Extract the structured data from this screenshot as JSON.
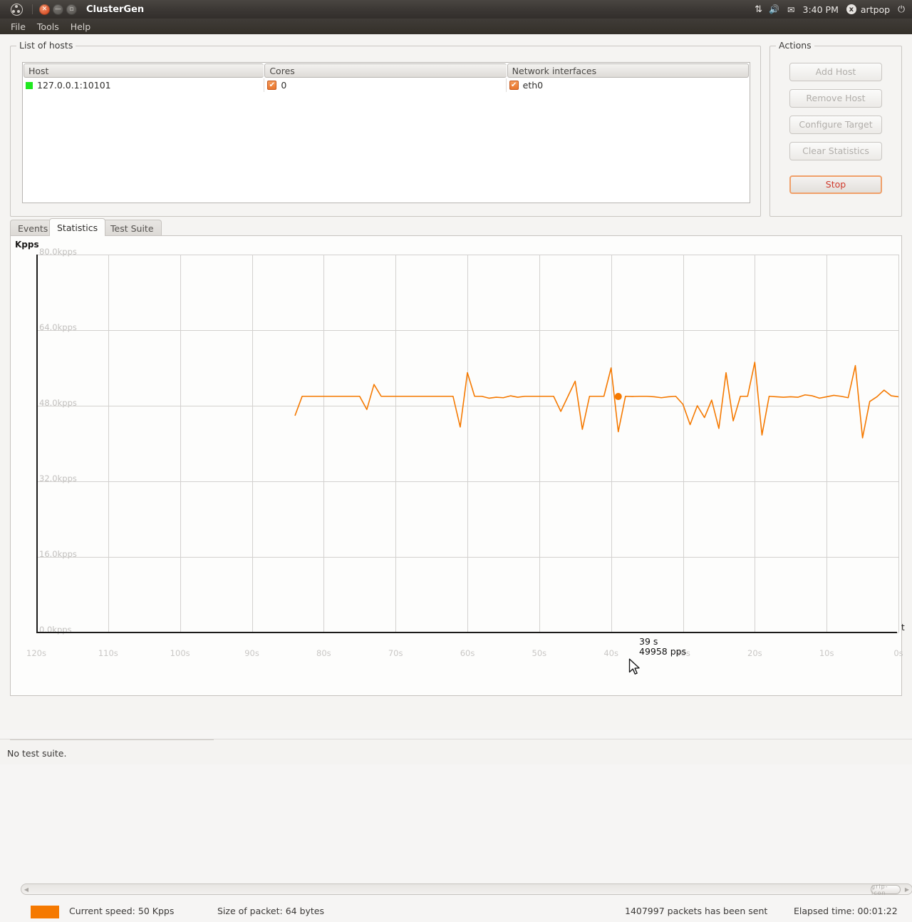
{
  "panel": {
    "window_title": "ClusterGen",
    "window_buttons": {
      "close": "close-icon",
      "minimize": "minimize-icon",
      "maximize": "maximize-icon"
    },
    "tray": {
      "network_icon": "network-updown-icon",
      "volume_icon": "volume-icon",
      "volume_dots": "---",
      "mail_icon": "mail-envelope-icon",
      "clock": "3:40 PM",
      "user_badge": "x",
      "user_name": "artpop",
      "power_icon": "power-icon"
    }
  },
  "menubar": {
    "items": [
      "File",
      "Tools",
      "Help"
    ]
  },
  "hosts": {
    "group_title": "List of hosts",
    "columns": [
      "Host",
      "Cores",
      "Network interfaces"
    ],
    "rows": [
      {
        "status": "online",
        "host": "127.0.0.1:10101",
        "cores_checked": true,
        "cores": "0",
        "iface_checked": true,
        "iface": "eth0"
      }
    ]
  },
  "actions": {
    "group_title": "Actions",
    "buttons": [
      {
        "label": "Add Host",
        "enabled": false
      },
      {
        "label": "Remove Host",
        "enabled": false
      },
      {
        "label": "Configure Target",
        "enabled": false
      },
      {
        "label": "Clear Statistics",
        "enabled": false
      },
      {
        "label": "Stop",
        "enabled": true,
        "primary": true
      }
    ]
  },
  "tabs": [
    {
      "label": "Events",
      "active": false
    },
    {
      "label": "Statistics",
      "active": true
    },
    {
      "label": "Test Suite",
      "active": false
    }
  ],
  "chart_data": {
    "type": "line",
    "title": "",
    "axis_corner_label": "Kpps",
    "xlabel": "t",
    "ylabel": "Kpps",
    "ylim": [
      0,
      80
    ],
    "xlim": [
      120,
      0
    ],
    "grid": true,
    "legend_position": "below-chart",
    "ytick_labels": [
      "80.0kpps",
      "64.0kpps",
      "48.0kpps",
      "32.0kpps",
      "16.0kpps",
      "0.0kpps"
    ],
    "ytick_values": [
      80,
      64,
      48,
      32,
      16,
      0
    ],
    "xtick_labels": [
      "120s",
      "110s",
      "100s",
      "90s",
      "80s",
      "70s",
      "60s",
      "50s",
      "40s",
      "30s",
      "20s",
      "10s",
      "0s"
    ],
    "xtick_values": [
      120,
      110,
      100,
      90,
      80,
      70,
      60,
      50,
      40,
      30,
      20,
      10,
      0
    ],
    "series": [
      {
        "name": "Current speed",
        "color": "#f57900",
        "unit": "pps",
        "x": [
          84,
          83,
          82,
          81,
          80,
          79,
          78,
          77,
          76,
          75,
          74,
          73,
          72,
          71,
          70,
          69,
          68,
          67,
          66,
          65,
          64,
          63,
          62,
          61,
          60,
          59,
          58,
          57,
          56,
          55,
          54,
          53,
          52,
          51,
          50,
          49,
          48,
          47,
          46,
          45,
          44,
          43,
          42,
          41,
          40,
          39,
          38,
          37,
          36,
          35,
          34,
          33,
          32,
          31,
          30,
          29,
          28,
          27,
          26,
          25,
          24,
          23,
          22,
          21,
          20,
          19,
          18,
          17,
          16,
          15,
          14,
          13,
          12,
          11,
          10,
          9,
          8,
          7,
          6,
          5,
          4,
          3,
          2,
          1,
          0
        ],
        "values": [
          45900,
          50000,
          50000,
          50000,
          50000,
          50000,
          50000,
          50000,
          50000,
          50000,
          47200,
          52500,
          50000,
          50000,
          50000,
          50000,
          50000,
          50000,
          50000,
          50000,
          50000,
          50000,
          50000,
          43500,
          55000,
          50000,
          50000,
          49600,
          49800,
          49700,
          50100,
          49800,
          50000,
          50000,
          50000,
          50000,
          50000,
          46800,
          50000,
          53200,
          43000,
          50000,
          50000,
          50000,
          56000,
          42500,
          50000,
          49958,
          50000,
          50000,
          49900,
          49700,
          49900,
          50000,
          48300,
          44000,
          48000,
          45500,
          49200,
          43200,
          55000,
          44800,
          50000,
          50000,
          57200,
          41800,
          50000,
          49900,
          49800,
          49900,
          49800,
          50300,
          50100,
          49600,
          49900,
          50200,
          50000,
          49700,
          56500,
          41200,
          48900,
          49900,
          51300,
          50100,
          49900
        ]
      }
    ],
    "annotation": {
      "time_label": "39 s",
      "value_label": "49958 pps",
      "point_x": 39,
      "point_y": 49958,
      "marker_color": "#f57900"
    }
  },
  "scrollbar": {
    "left_arrow": "chevron-left-icon",
    "right_arrow": "chevron-right-icon",
    "thumb_grip": "grip-icon"
  },
  "infobar": {
    "legend_color": "#f57900",
    "current_speed": "Current speed: 50 Kpps",
    "packet_size": "Size of packet: 64 bytes",
    "packets_sent": "1407997 packets has been sent",
    "elapsed_time": "Elapsed time: 00:01:22"
  },
  "statusbar": {
    "message": "No test suite."
  }
}
